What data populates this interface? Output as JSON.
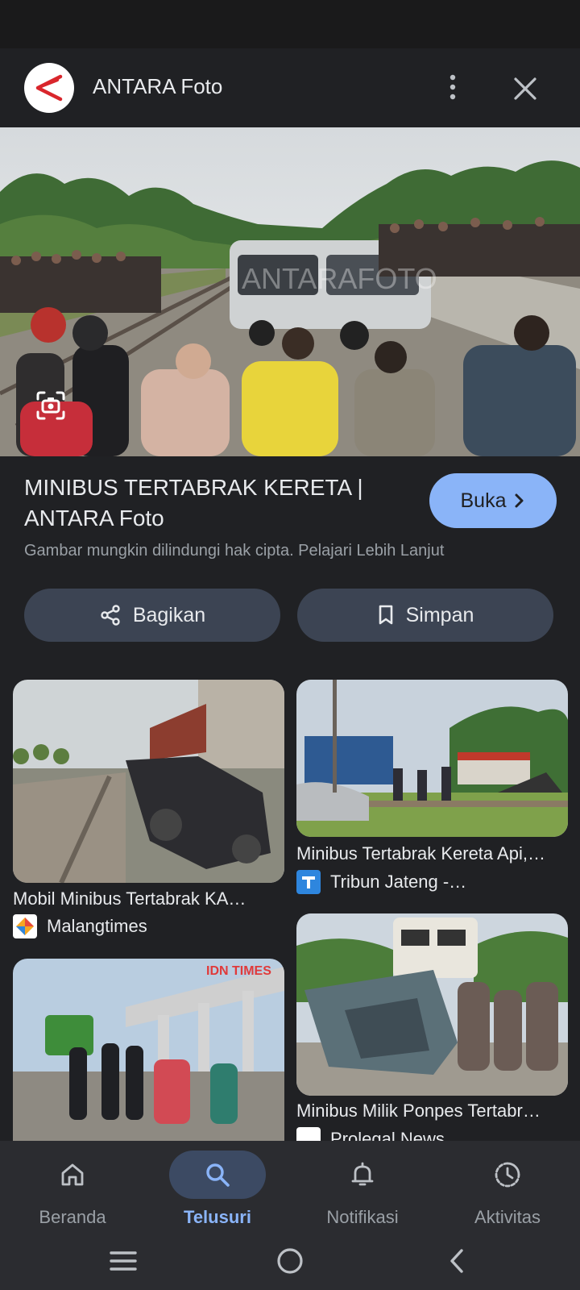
{
  "header": {
    "title": "ANTARA Foto",
    "more_icon": "more-vert-icon",
    "close_icon": "close-icon"
  },
  "hero": {
    "image_desc": "photo",
    "watermark": "ANTARAFOTO"
  },
  "result": {
    "title_line1": "MINIBUS TERTABRAK KERETA |",
    "title_line2": "ANTARA Foto",
    "open_label": "Buka",
    "copyright_text": "Gambar mungkin dilindungi hak cipta. Pelajari Lebih Lanjut"
  },
  "actions": {
    "share_label": "Bagikan",
    "save_label": "Simpan"
  },
  "related": [
    {
      "title": "Mobil Minibus Tertabrak KA…",
      "source": "Malangtimes"
    },
    {
      "title": "Minibus Tertabrak Kereta Api,…",
      "source": "Tribun Jateng -…"
    },
    {
      "title": "",
      "source": "",
      "badge": "IDN TIMES"
    },
    {
      "title": "Minibus Milik Ponpes Tertabr…",
      "source": "Prolegal News"
    }
  ],
  "bottom_nav": [
    {
      "label": "Beranda",
      "icon": "home-icon",
      "active": false
    },
    {
      "label": "Telusuri",
      "icon": "search-icon",
      "active": true
    },
    {
      "label": "Notifikasi",
      "icon": "bell-icon",
      "active": false
    },
    {
      "label": "Aktivitas",
      "icon": "activity-icon",
      "active": false
    }
  ],
  "colors": {
    "accent": "#8ab4f8",
    "background": "#202124",
    "button_bg": "#3c4453"
  }
}
